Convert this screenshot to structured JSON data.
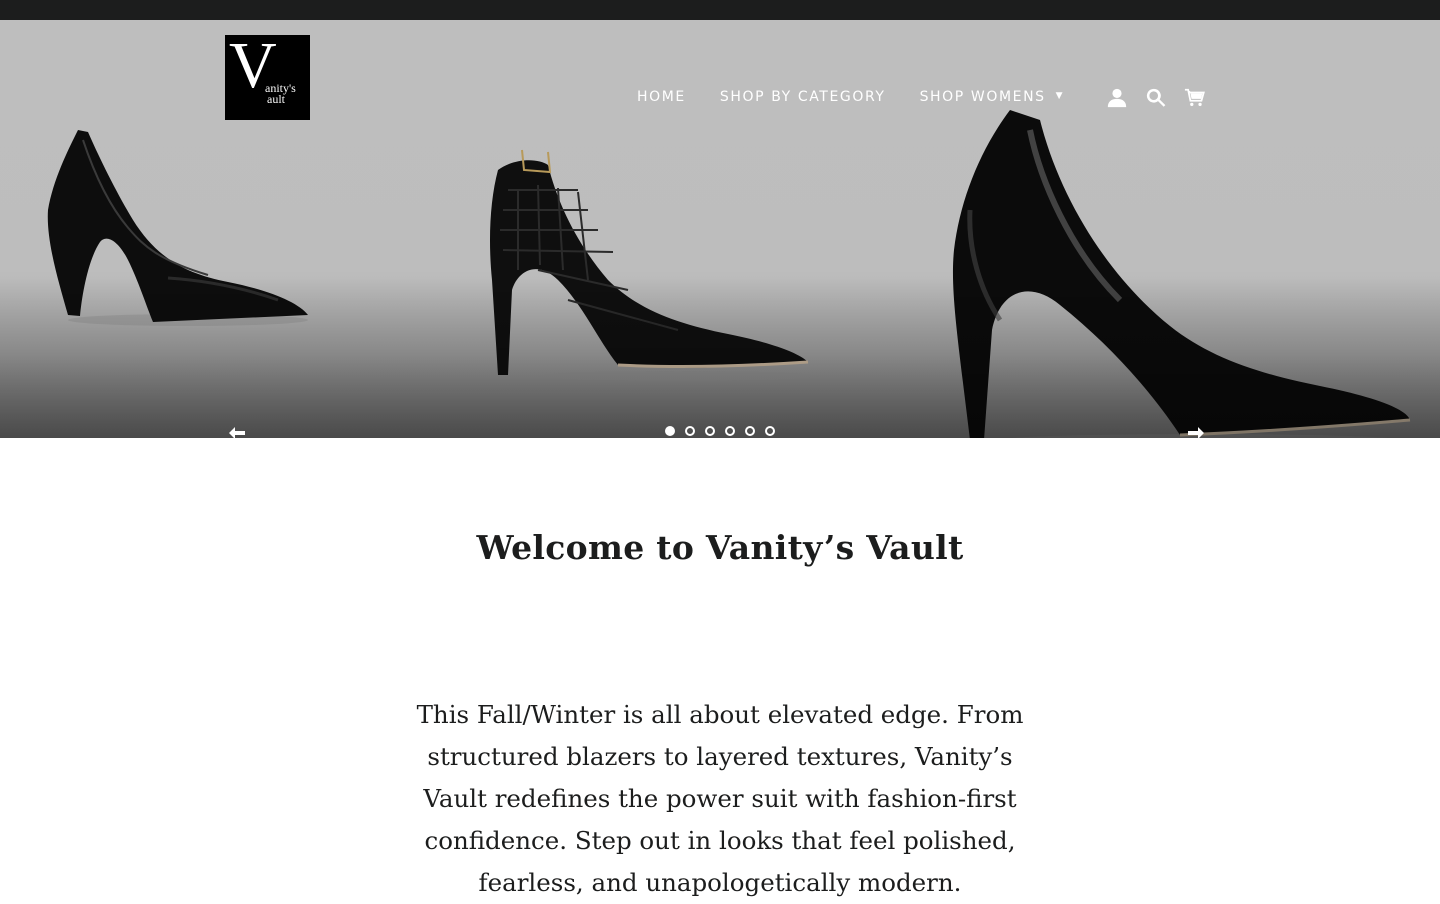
{
  "brand": {
    "logo_letter": "V",
    "logo_line1": "anity's",
    "logo_line2": "ault"
  },
  "nav": {
    "items": [
      {
        "label": "HOME"
      },
      {
        "label": "SHOP BY CATEGORY"
      },
      {
        "label": "SHOP WOMENS",
        "has_dropdown": true
      }
    ],
    "caret": "▼",
    "icons": [
      "account-icon",
      "search-icon",
      "cart-icon"
    ]
  },
  "slideshow": {
    "slide_count": 6,
    "active_slide": 1,
    "prev_icon": "arrow-left-icon",
    "next_icon": "arrow-right-icon"
  },
  "main": {
    "welcome_title": "Welcome to Vanity’s Vault",
    "intro_text": "This Fall/Winter is all about elevated edge. From structured blazers to layered textures, Vanity’s Vault redefines the power suit with fashion-first confidence. Step out in looks that feel polished, fearless, and unapologetically modern."
  },
  "colors": {
    "topbar": "#1c1d1d",
    "hero_bg": "#bebebe",
    "text": "#1c1d1d",
    "nav_text": "#ffffff"
  }
}
